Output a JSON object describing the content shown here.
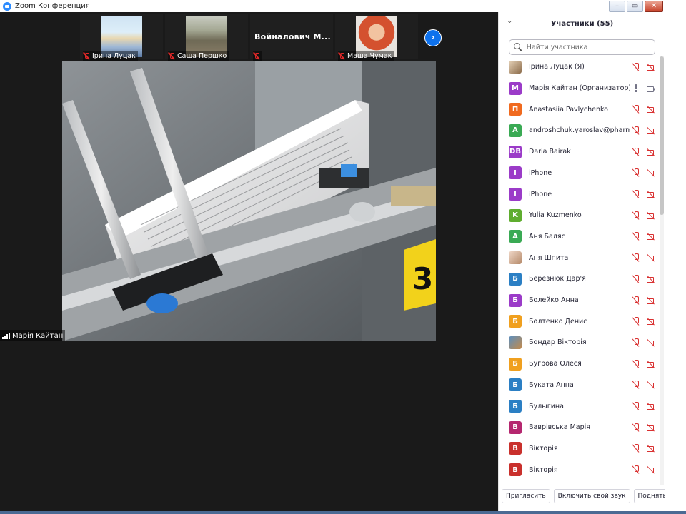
{
  "window": {
    "title": "Zoom Конференция",
    "controls": {
      "minimize": "–",
      "restore": "▭",
      "close": "✕"
    }
  },
  "thumbnails": [
    {
      "name": "Ірина Луцак",
      "muted": true,
      "has_video": true
    },
    {
      "name": "Саша Першко",
      "muted": true,
      "has_video": true
    },
    {
      "name": "Войналович  М...",
      "muted": true,
      "has_video": false
    },
    {
      "name": "Маша Чумак",
      "muted": true,
      "has_video": true
    }
  ],
  "next_page_icon": "chevron-right-icon",
  "active_speaker": {
    "name": "Марія Кайтан"
  },
  "panel": {
    "title": "Участники (55)",
    "collapse_icon": "chevron-down-icon",
    "search_placeholder": "Найти участника",
    "participants": [
      {
        "name": "Ірина Луцак (Я)",
        "avatar": "",
        "color": "photo",
        "mic": "off",
        "cam": "off"
      },
      {
        "name": "Марія Кайтан (Организатор)",
        "avatar": "М",
        "color": "#9b3bc8",
        "mic": "on",
        "cam": "on"
      },
      {
        "name": "Anastasiia Pavlychenko",
        "avatar": "П",
        "color": "#f06a1f",
        "mic": "off",
        "cam": "off"
      },
      {
        "name": "androshchuk.yaroslav@pharm.z...",
        "avatar": "A",
        "color": "#3aaa54",
        "mic": "off",
        "cam": "off"
      },
      {
        "name": "Daria Bairak",
        "avatar": "DB",
        "color": "#9b3bc8",
        "mic": "off",
        "cam": "off"
      },
      {
        "name": "iPhone",
        "avatar": "I",
        "color": "#9b3bc8",
        "mic": "off",
        "cam": "off"
      },
      {
        "name": "iPhone",
        "avatar": "I",
        "color": "#9b3bc8",
        "mic": "off",
        "cam": "off"
      },
      {
        "name": "Yulia Kuzmenko",
        "avatar": "K",
        "color": "#5fad2f",
        "mic": "off",
        "cam": "off"
      },
      {
        "name": "Аня Баляс",
        "avatar": "A",
        "color": "#3aaa54",
        "mic": "off",
        "cam": "off"
      },
      {
        "name": "Аня Шпита",
        "avatar": "",
        "color": "photo2",
        "mic": "off",
        "cam": "off"
      },
      {
        "name": "Березнюк Дар'я",
        "avatar": "Б",
        "color": "#2b7fc4",
        "mic": "off",
        "cam": "off"
      },
      {
        "name": "Болейко Анна",
        "avatar": "Б",
        "color": "#9b3bc8",
        "mic": "off",
        "cam": "off"
      },
      {
        "name": "Болтенко Денис",
        "avatar": "Б",
        "color": "#f0a01f",
        "mic": "off",
        "cam": "off"
      },
      {
        "name": "Бондар Вікторія",
        "avatar": "",
        "color": "photo3",
        "mic": "off",
        "cam": "off"
      },
      {
        "name": "Бугрова Олеся",
        "avatar": "Б",
        "color": "#f0a01f",
        "mic": "off",
        "cam": "off"
      },
      {
        "name": "Буката Анна",
        "avatar": "Б",
        "color": "#2b7fc4",
        "mic": "off",
        "cam": "off"
      },
      {
        "name": "Булыгина",
        "avatar": "Б",
        "color": "#2b7fc4",
        "mic": "off",
        "cam": "off"
      },
      {
        "name": "Ваврівська Марія",
        "avatar": "В",
        "color": "#b5276f",
        "mic": "off",
        "cam": "off"
      },
      {
        "name": "Вікторія",
        "avatar": "В",
        "color": "#c9302c",
        "mic": "off",
        "cam": "off"
      },
      {
        "name": "Вікторія",
        "avatar": "В",
        "color": "#c9302c",
        "mic": "off",
        "cam": "off"
      }
    ],
    "footer": {
      "invite": "Пригласить",
      "unmute": "Включить свой звук",
      "raise_hand": "Поднять руку"
    }
  }
}
